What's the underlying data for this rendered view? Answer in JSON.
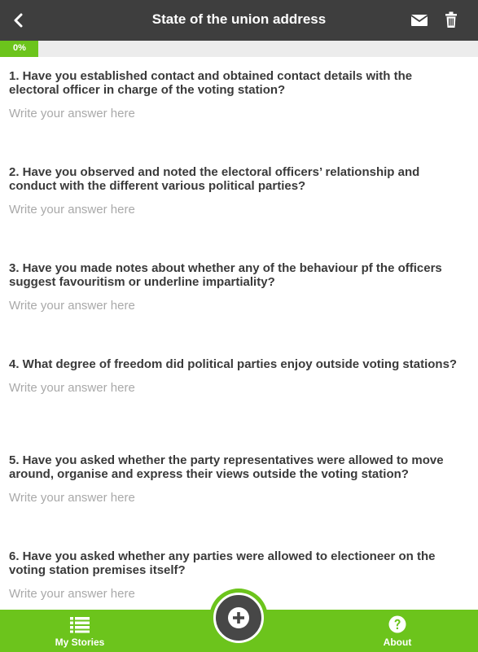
{
  "header": {
    "title": "State of the union address",
    "back_icon": "chevron-left-icon",
    "mail_icon": "envelope-icon",
    "delete_icon": "trash-icon"
  },
  "progress": {
    "value": 0,
    "label": "0%",
    "color": "#6cc41c"
  },
  "questions": [
    {
      "text": "1. Have you established contact and obtained contact details with the electoral officer in charge of the voting station?",
      "placeholder": "Write your answer here",
      "value": ""
    },
    {
      "text": "2. Have you observed and noted the electoral officers’ relationship and conduct with the different various political parties?",
      "placeholder": "Write your answer here",
      "value": ""
    },
    {
      "text": "3. Have you made notes about whether any of the behaviour pf the officers suggest favouritism or underline impartiality?",
      "placeholder": "Write your answer here",
      "value": ""
    },
    {
      "text": "4. What degree of freedom did political parties enjoy outside voting stations?",
      "placeholder": "Write your answer here",
      "value": ""
    },
    {
      "text": "5. Have you asked whether the party representatives were allowed to move around, organise and express their views outside the voting station?",
      "placeholder": "Write your answer here",
      "value": ""
    },
    {
      "text": "6. Have you asked whether any parties were allowed to electioneer on the voting station premises itself?",
      "placeholder": "Write your answer here",
      "value": ""
    }
  ],
  "bottom_nav": {
    "my_stories": {
      "label": "My Stories",
      "icon": "list-icon"
    },
    "add": {
      "icon": "plus-icon"
    },
    "about": {
      "label": "About",
      "icon": "question-circle-icon"
    }
  },
  "colors": {
    "header_bg": "#3e3e3e",
    "accent": "#6cc41c",
    "fab_bg": "#474747"
  }
}
